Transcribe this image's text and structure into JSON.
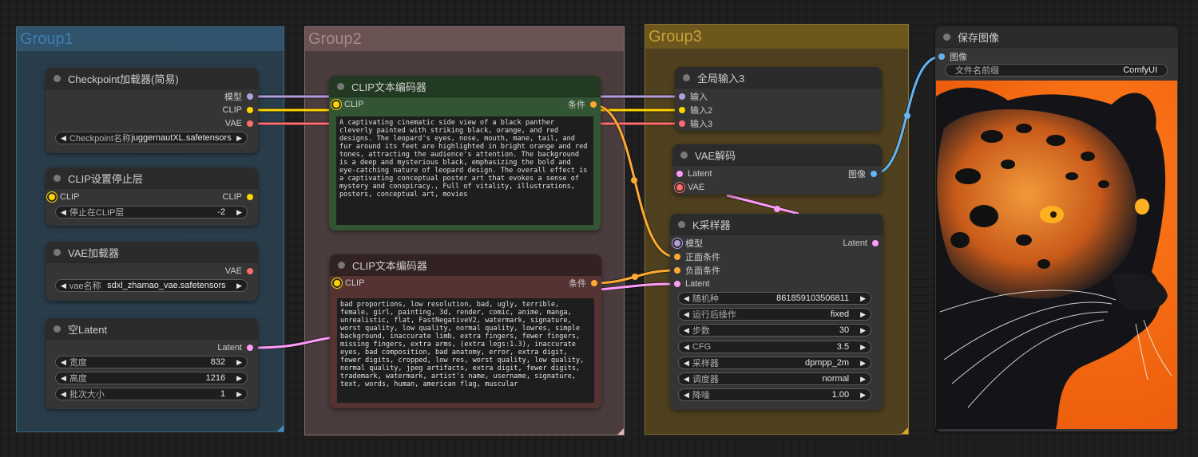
{
  "colors": {
    "model": "#b39ddb",
    "clip": "#ffd500",
    "vae": "#ff6e6e",
    "latent": "#ff9cf9",
    "conditioning": "#ffa931",
    "image": "#64b5f6"
  },
  "groups": [
    {
      "title": "Group1"
    },
    {
      "title": "Group2"
    },
    {
      "title": "Group3"
    }
  ],
  "nodes": {
    "checkpoint_loader": {
      "title": "Checkpoint加载器(简易)",
      "outputs": [
        "模型",
        "CLIP",
        "VAE"
      ],
      "widgets": [
        {
          "label": "Checkpoint名称",
          "value": "juggernautXL.safetensors"
        }
      ]
    },
    "clip_set_last_layer": {
      "title": "CLIP设置停止层",
      "inputs": [
        "CLIP"
      ],
      "outputs": [
        "CLIP"
      ],
      "widgets": [
        {
          "label": "停止在CLIP层",
          "value": "-2"
        }
      ]
    },
    "vae_loader": {
      "title": "VAE加载器",
      "outputs": [
        "VAE"
      ],
      "widgets": [
        {
          "label": "vae名称",
          "value": "sdxl_zhamao_vae.safetensors"
        }
      ]
    },
    "empty_latent": {
      "title": "空Latent",
      "outputs": [
        "Latent"
      ],
      "widgets": [
        {
          "label": "宽度",
          "value": "832"
        },
        {
          "label": "高度",
          "value": "1216"
        },
        {
          "label": "批次大小",
          "value": "1"
        }
      ]
    },
    "clip_text_positive": {
      "title": "CLIP文本编码器",
      "inputs": [
        "CLIP"
      ],
      "outputs": [
        "条件"
      ],
      "text": "A captivating cinematic side view of a black panther cleverly painted with striking black, orange, and red designs. The leopard's eyes, nose, mouth, mane, tail, and fur around its feet are highlighted in bright orange and red tones, attracting the audience's attention. The background is a deep and mysterious black, emphasizing the bold and eye-catching nature of leopard design. The overall effect is a captivating conceptual poster art that evokes a sense of mystery and conspiracy., Full of vitality, illustrations, posters, conceptual art, movies"
    },
    "clip_text_negative": {
      "title": "CLIP文本编码器",
      "inputs": [
        "CLIP"
      ],
      "outputs": [
        "条件"
      ],
      "text": "bad proportions, low resolution, bad, ugly, terrible, female, girl, painting, 3d, render, comic, anime, manga, unrealistic, flat, FastNegativeV2, watermark, signature, worst quality, low quality, normal quality, lowres, simple background, inaccurate limb, extra fingers, fewer fingers, missing fingers, extra arms, (extra legs:1.3), inaccurate eyes, bad composition, bad anatomy, error, extra digit, fewer digits, cropped, low res, worst quality, low quality, normal quality, jpeg artifacts, extra digit, fewer digits, trademark, watermark, artist's name, username, signature, text, words, human, american flag, muscular"
    },
    "global_input": {
      "title": "全局输入3",
      "inputs": [
        "输入",
        "输入2",
        "输入3"
      ]
    },
    "vae_decode": {
      "title": "VAE解码",
      "inputs": [
        "Latent",
        "VAE"
      ],
      "outputs": [
        "图像"
      ]
    },
    "ksampler": {
      "title": "K采样器",
      "inputs": [
        "模型",
        "正面条件",
        "负面条件",
        "Latent"
      ],
      "outputs": [
        "Latent"
      ],
      "widgets": [
        {
          "label": "随机种",
          "value": "861859103506811"
        },
        {
          "label": "运行后操作",
          "value": "fixed"
        },
        {
          "label": "步数",
          "value": "30"
        },
        {
          "label": "CFG",
          "value": "3.5"
        },
        {
          "label": "采样器",
          "value": "dpmpp_2m"
        },
        {
          "label": "调度器",
          "value": "normal"
        },
        {
          "label": "降噪",
          "value": "1.00"
        }
      ]
    },
    "save_image": {
      "title": "保存图像",
      "inputs": [
        "图像"
      ],
      "widgets": [
        {
          "label": "文件名前缀",
          "value": "ComfyUI"
        }
      ],
      "preview": "leopard-portrait-orange-background"
    }
  },
  "icons": {
    "arrow_left": "◀",
    "arrow_right": "▶"
  }
}
